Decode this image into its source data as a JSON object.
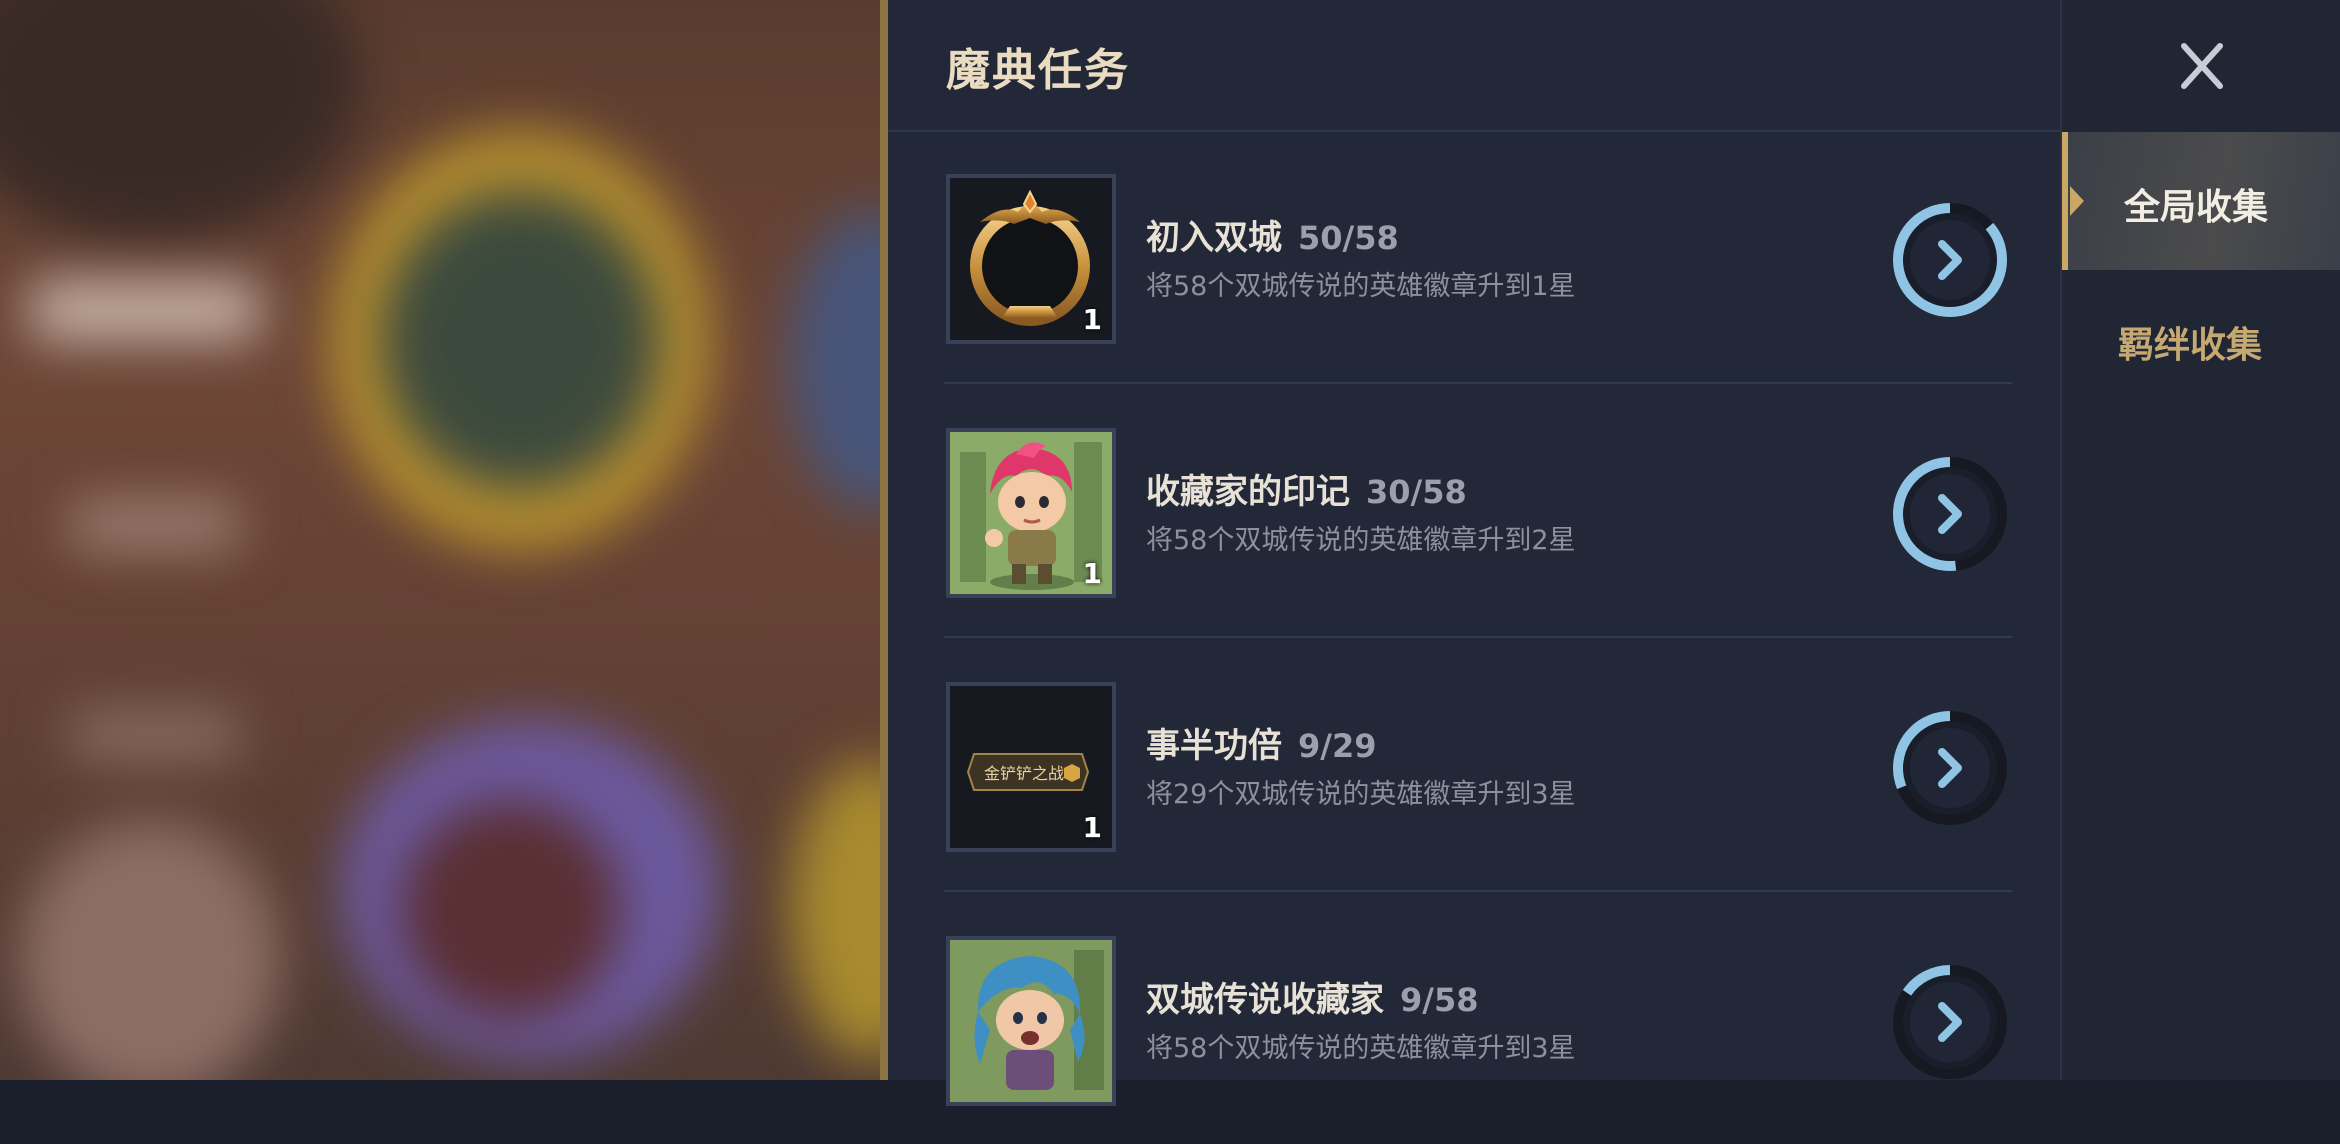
{
  "panel": {
    "title": "魔典任务"
  },
  "quests": [
    {
      "title": "初入双城",
      "progress": "50/58",
      "progress_value": 0.862,
      "description": "将58个双城传说的英雄徽章升到1星",
      "thumb_icon": "gold-ring-frame-icon",
      "thumb_count": "1"
    },
    {
      "title": "收藏家的印记",
      "progress": "30/58",
      "progress_value": 0.517,
      "description": "将58个双城传说的英雄徽章升到2星",
      "thumb_icon": "pink-hair-champion-portrait",
      "thumb_count": "1"
    },
    {
      "title": "事半功倍",
      "progress": "9/29",
      "progress_value": 0.31,
      "description": "将29个双城传说的英雄徽章升到3星",
      "thumb_icon": "golden-spatula-plaque-icon",
      "thumb_label": "金铲铲之战",
      "thumb_count": "1"
    },
    {
      "title": "双城传说收藏家",
      "progress": "9/58",
      "progress_value": 0.155,
      "description": "将58个双城传说的英雄徽章升到3星",
      "thumb_icon": "blue-hair-champion-portrait",
      "thumb_count": ""
    }
  ],
  "side_tabs": [
    {
      "label": "全局收集",
      "active": true
    },
    {
      "label": "羁绊收集",
      "active": false
    }
  ],
  "icons": {
    "close": "close-icon",
    "go": "chevron-right-icon"
  },
  "colors": {
    "panel_bg": "#232838",
    "gold_accent": "#c9a764",
    "progress_ring": "#8fc4e4",
    "title_text": "#e9dcc0"
  }
}
